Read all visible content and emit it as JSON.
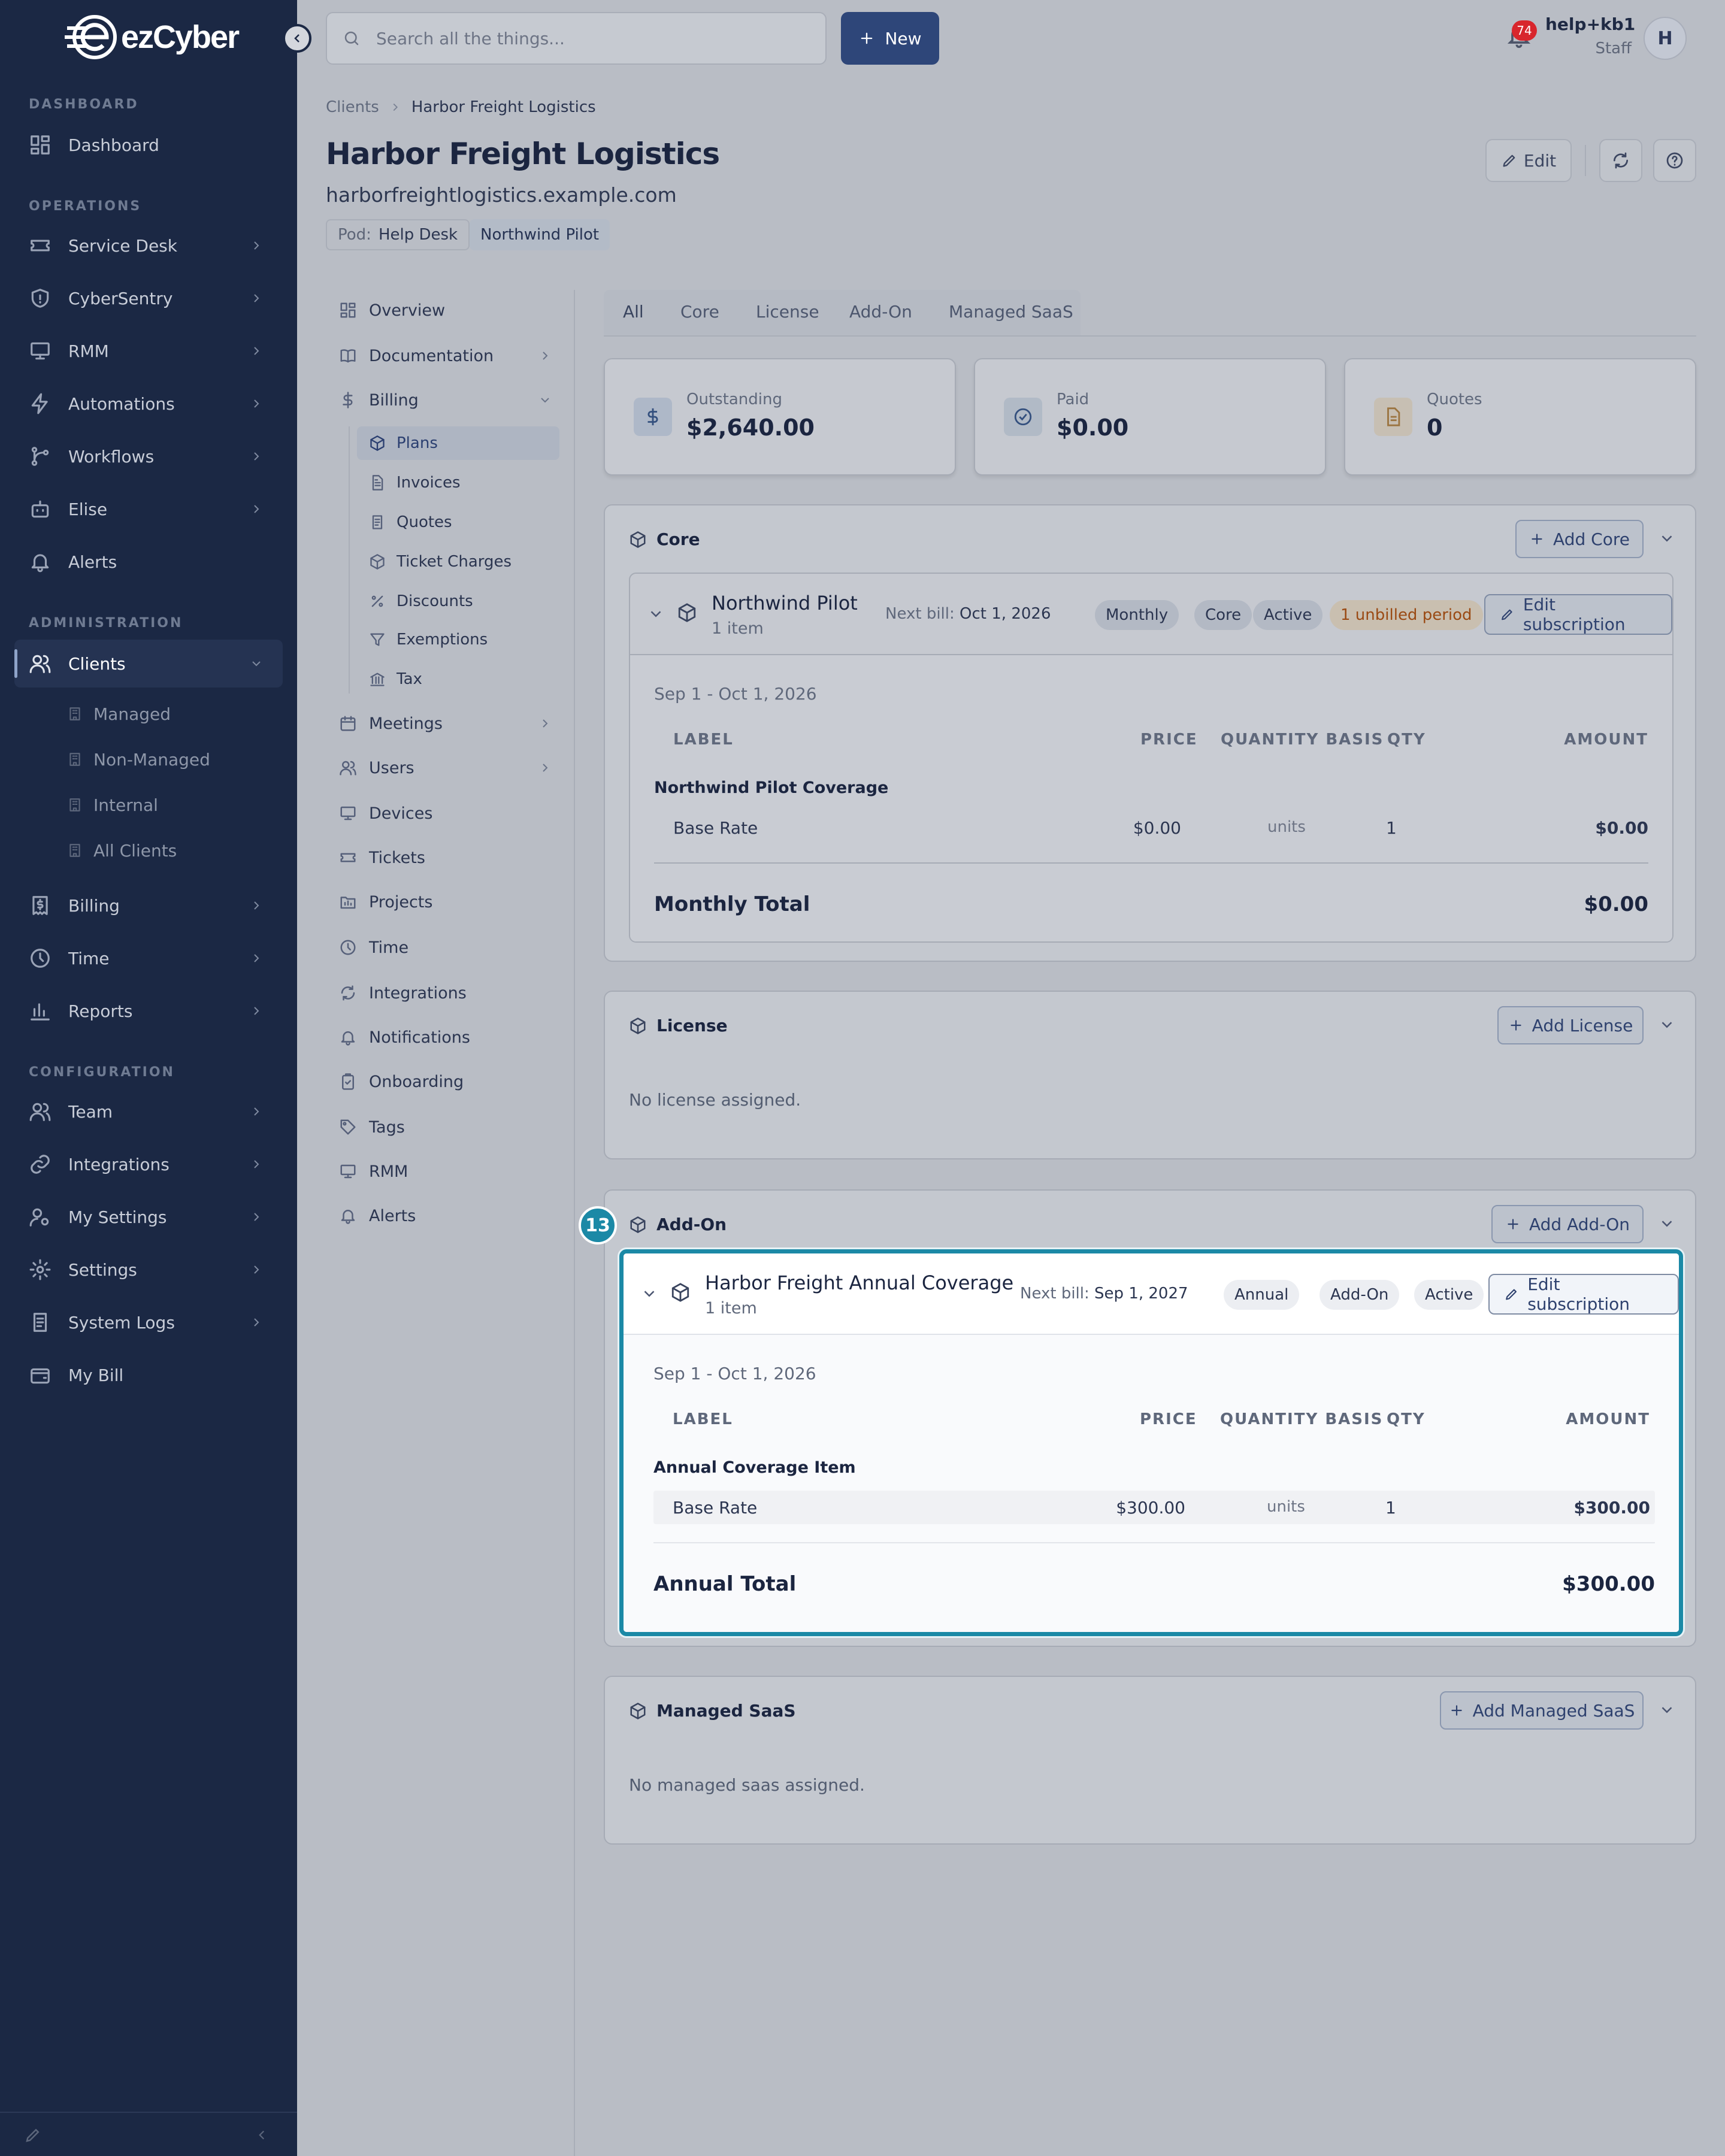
{
  "brand": {
    "name": "ezCyber"
  },
  "sidebar": {
    "sections": {
      "dashboard": "DASHBOARD",
      "operations": "OPERATIONS",
      "administration": "ADMINISTRATION",
      "configuration": "CONFIGURATION"
    },
    "items": [
      "Dashboard",
      "Service Desk",
      "CyberSentry",
      "RMM",
      "Automations",
      "Workflows",
      "Elise",
      "Alerts",
      "Clients",
      "Billing",
      "Time",
      "Reports",
      "Team",
      "Integrations",
      "My Settings",
      "Settings",
      "System Logs",
      "My Bill"
    ],
    "clients_sub": [
      "Managed",
      "Non-Managed",
      "Internal",
      "All Clients"
    ]
  },
  "topbar": {
    "search_placeholder": "Search all the things...",
    "new_label": "New",
    "notifications_count": "74",
    "user_name": "help+kb1",
    "user_role": "Staff",
    "avatar_initial": "H"
  },
  "breadcrumb": {
    "root": "Clients",
    "current": "Harbor Freight Logistics"
  },
  "client": {
    "title": "Harbor Freight Logistics",
    "domain": "harborfreightlogistics.example.com",
    "pod_label": "Pod:",
    "pod_value": "Help Desk",
    "tag": "Northwind Pilot",
    "edit_label": "Edit"
  },
  "subnav": {
    "items": [
      "Overview",
      "Documentation",
      "Billing",
      "Meetings",
      "Users",
      "Devices",
      "Tickets",
      "Projects",
      "Time",
      "Integrations",
      "Notifications",
      "Onboarding",
      "Tags",
      "RMM",
      "Alerts"
    ],
    "billing_sub": [
      "Plans",
      "Invoices",
      "Quotes",
      "Ticket Charges",
      "Discounts",
      "Exemptions",
      "Tax"
    ]
  },
  "filter_tabs": [
    "All",
    "Core",
    "License",
    "Add-On",
    "Managed SaaS"
  ],
  "stats": {
    "outstanding": {
      "label": "Outstanding",
      "value": "$2,640.00"
    },
    "paid": {
      "label": "Paid",
      "value": "$0.00"
    },
    "quotes": {
      "label": "Quotes",
      "value": "0"
    }
  },
  "columns": {
    "label": "LABEL",
    "price": "PRICE",
    "basis": "QUANTITY BASIS",
    "qty": "QTY",
    "amount": "AMOUNT"
  },
  "edit_subscription_label": "Edit subscription",
  "next_bill_label": "Next bill:",
  "core": {
    "title": "Core",
    "add_label": "Add Core",
    "sub": {
      "name": "Northwind Pilot",
      "items": "1 item",
      "next_bill": "Oct 1, 2026",
      "pills": [
        "Monthly",
        "Core",
        "Active"
      ],
      "warning": "1 unbilled period",
      "period": "Sep 1 - Oct 1, 2026",
      "group": "Northwind Pilot Coverage",
      "row": {
        "label": "Base Rate",
        "price": "$0.00",
        "basis": "units",
        "qty": "1",
        "amount": "$0.00"
      },
      "total_label": "Monthly Total",
      "total_value": "$0.00"
    }
  },
  "license": {
    "title": "License",
    "add_label": "Add License",
    "empty": "No license assigned."
  },
  "addon": {
    "title": "Add-On",
    "add_label": "Add Add-On",
    "marker": "13",
    "sub": {
      "name": "Harbor Freight Annual Coverage",
      "items": "1 item",
      "next_bill": "Sep 1, 2027",
      "pills": [
        "Annual",
        "Add-On",
        "Active"
      ],
      "period": "Sep 1 - Oct 1, 2026",
      "group": "Annual Coverage Item",
      "row": {
        "label": "Base Rate",
        "price": "$300.00",
        "basis": "units",
        "qty": "1",
        "amount": "$300.00"
      },
      "total_label": "Annual Total",
      "total_value": "$300.00"
    }
  },
  "managed_saas": {
    "title": "Managed SaaS",
    "add_label": "Add Managed SaaS",
    "empty": "No managed saas assigned."
  },
  "colors": {
    "accent": "#2e4679",
    "highlight": "#1b89a6",
    "sidebar": "#1b2844",
    "warning": "#9a4a14"
  }
}
